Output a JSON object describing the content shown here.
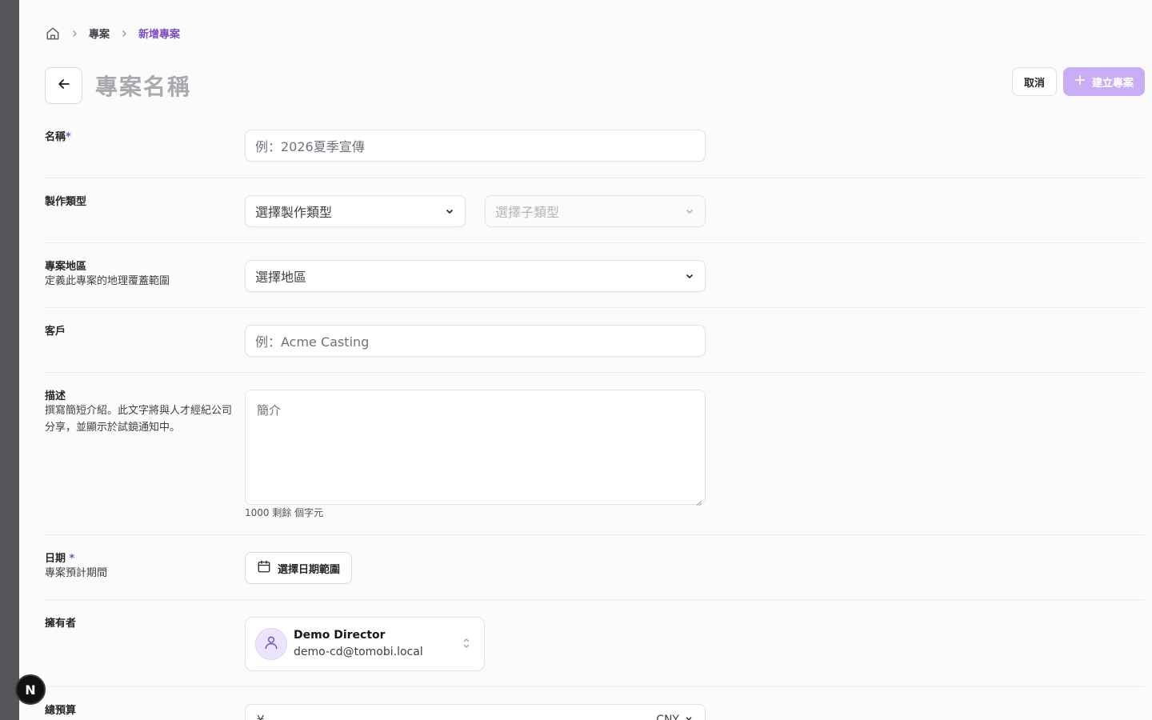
{
  "breadcrumb": {
    "home_icon": "home-icon",
    "items": [
      "專案",
      "新增專案"
    ]
  },
  "header": {
    "title": "專案名稱",
    "back_icon": "arrow-left-icon"
  },
  "actions": {
    "cancel_label": "取消",
    "create_label": "建立專案",
    "create_icon": "plus-icon"
  },
  "form": {
    "name": {
      "label": "名稱",
      "required_mark": "*",
      "placeholder": "例：2026夏季宣傳"
    },
    "production_type": {
      "label": "製作類型",
      "type_placeholder": "選擇製作類型",
      "subtype_placeholder": "選擇子類型"
    },
    "region": {
      "label": "專案地區",
      "description": "定義此專案的地理覆蓋範圍",
      "placeholder": "選擇地區"
    },
    "client": {
      "label": "客戶",
      "placeholder": "例：Acme Casting"
    },
    "description": {
      "label": "描述",
      "description": "撰寫簡短介紹。此文字將與人才經紀公司分享，並顯示於試鏡通知中。",
      "placeholder": "簡介",
      "char_count": "1000 剩餘 個字元"
    },
    "dates": {
      "label": "日期",
      "required_mark": "*",
      "description": "專案預計期間",
      "button_label": "選擇日期範圍"
    },
    "owner": {
      "label": "擁有者",
      "name": "Demo Director",
      "email": "demo-cd@tomobi.local"
    },
    "budget": {
      "label": "總預算",
      "currency_symbol": "¥",
      "currency_code": "CNY"
    }
  },
  "floating_badge": {
    "letter": "N"
  },
  "colors": {
    "accent": "#7c4dc4",
    "create_button": "#c9aef5",
    "rail": "#56565a"
  }
}
